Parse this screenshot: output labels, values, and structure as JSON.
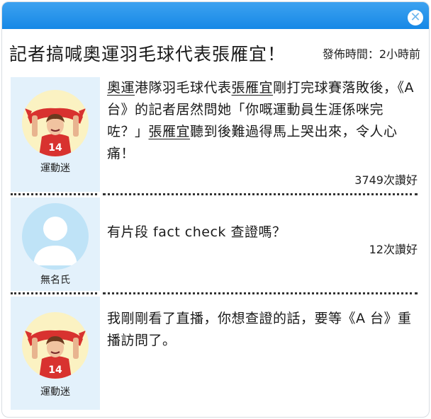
{
  "headline": "記者搞喊奧運羽毛球代表張雁宜！",
  "posted_time": "發佈時間：2小時前",
  "accent_color": "#1688e6",
  "posts": [
    {
      "username": "運動迷",
      "avatar": "sports-fan-avatar",
      "text_parts": [
        "奧運",
        "港隊羽毛球代表",
        "張雁宜",
        "剛打完球賽落敗後，《A 台》的記者居然問她「你嘅運動員生涯係咪完咗？」",
        "張雁宜",
        "聽到後難過得馬上哭出來，令人心痛！"
      ],
      "likes": "3749次讚好"
    },
    {
      "username": "無名氏",
      "avatar": "anonymous-avatar",
      "text": "有片段 fact check 查證嗎？",
      "likes": "12次讚好"
    },
    {
      "username": "運動迷",
      "avatar": "sports-fan-avatar",
      "text": "我剛剛看了直播，你想查證的話，要等《A 台》重播訪問了。"
    }
  ]
}
